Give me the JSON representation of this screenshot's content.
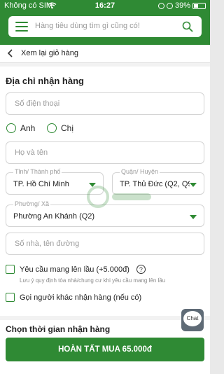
{
  "status_bar": {
    "carrier": "Không có SIM",
    "time": "16:27",
    "battery": "39%"
  },
  "search": {
    "placeholder": "Hàng tiêu dùng tìm gì cũng có!"
  },
  "nav": {
    "back_label": "Xem lại giỏ hàng"
  },
  "address": {
    "title": "Địa chỉ nhận hàng",
    "phone_placeholder": "Số điện thoại",
    "gender_options": [
      "Anh",
      "Chị"
    ],
    "name_placeholder": "Họ và tên",
    "province_label": "Tỉnh/ Thành phố",
    "province_value": "TP. Hồ Chí Minh",
    "district_label": "Quận/ Huyện",
    "district_value": "TP. Thủ Đức (Q2, Q9...",
    "ward_label": "Phường/ Xã",
    "ward_value": "Phường An Khánh (Q2)",
    "street_placeholder": "Số nhà, tên đường"
  },
  "options": {
    "upstairs_label": "Yêu cầu mang lên lầu (+5.000đ)",
    "upstairs_note": "Lưu ý quy định tòa nhà/chung cư khi yêu cầu mang lên lầu",
    "other_receiver_label": "Gọi người khác nhận hàng (nếu có)"
  },
  "delivery": {
    "title": "Chọn thời gian nhận hàng"
  },
  "chat": {
    "label": "Chat"
  },
  "submit": {
    "label": "HOÀN TẤT MUA 65.000đ"
  },
  "colors": {
    "brand_green": "#2f8a34"
  }
}
